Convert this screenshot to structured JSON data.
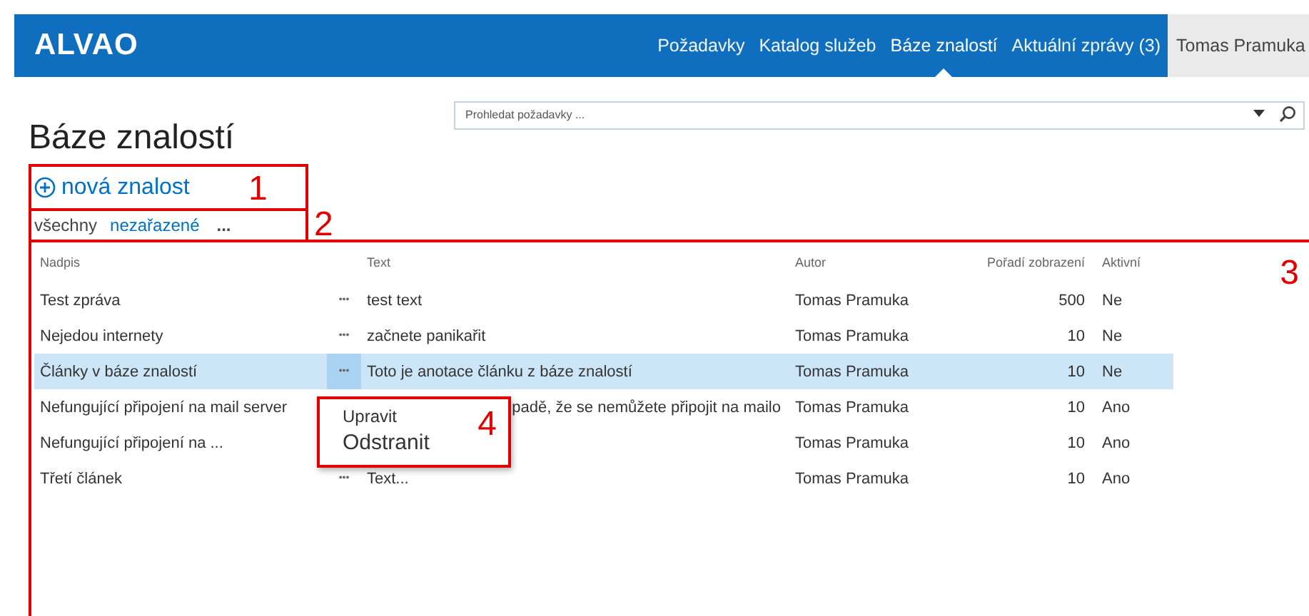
{
  "header": {
    "logo": "ALVAO",
    "nav": [
      {
        "label": "Požadavky",
        "selected": false
      },
      {
        "label": "Katalog služeb",
        "selected": false
      },
      {
        "label": "Báze znalostí",
        "selected": true
      },
      {
        "label": "Aktuální zprávy (3)",
        "selected": false
      }
    ],
    "user": "Tomas Pramuka"
  },
  "search": {
    "placeholder": "Prohledat požadavky ..."
  },
  "title": "Báze znalostí",
  "new_item": {
    "label": "nová znalost",
    "annotation": "1"
  },
  "filters": {
    "annotation": "2",
    "items": [
      {
        "label": "všechny",
        "selected": true
      },
      {
        "label": "nezařazené",
        "selected": false
      }
    ],
    "more": "..."
  },
  "table": {
    "annotation": "3",
    "columns": [
      "Nadpis",
      "Text",
      "Autor",
      "Pořadí zobrazení",
      "Aktivní"
    ],
    "rows": [
      {
        "title": "Test zpráva",
        "more": "•••",
        "text": "test text",
        "author": "Tomas Pramuka",
        "order": "500",
        "active": "Ne",
        "selected": false
      },
      {
        "title": "Nejedou internety",
        "more": "•••",
        "text": "začnete panikařit",
        "author": "Tomas Pramuka",
        "order": "10",
        "active": "Ne",
        "selected": false
      },
      {
        "title": "Články v báze znalostí",
        "more": "•••",
        "text": "Toto je anotace článku z báze znalostí",
        "author": "Tomas Pramuka",
        "order": "10",
        "active": "Ne",
        "selected": true
      },
      {
        "title": "Nefungující připojení na mail server",
        "text": "padě, že se nemůžete připojit na mailo",
        "author": "Tomas Pramuka",
        "order": "10",
        "active": "Ano",
        "selected": false
      },
      {
        "title": "Nefungující připojení na ...",
        "author": "Tomas Pramuka",
        "order": "10",
        "active": "Ano",
        "selected": false
      },
      {
        "title": "Třetí článek",
        "more": "•••",
        "text": "Text...",
        "author": "Tomas Pramuka",
        "order": "10",
        "active": "Ano",
        "selected": false
      }
    ]
  },
  "context_menu": {
    "annotation": "4",
    "items": [
      "Upravit",
      "Odstranit"
    ]
  }
}
